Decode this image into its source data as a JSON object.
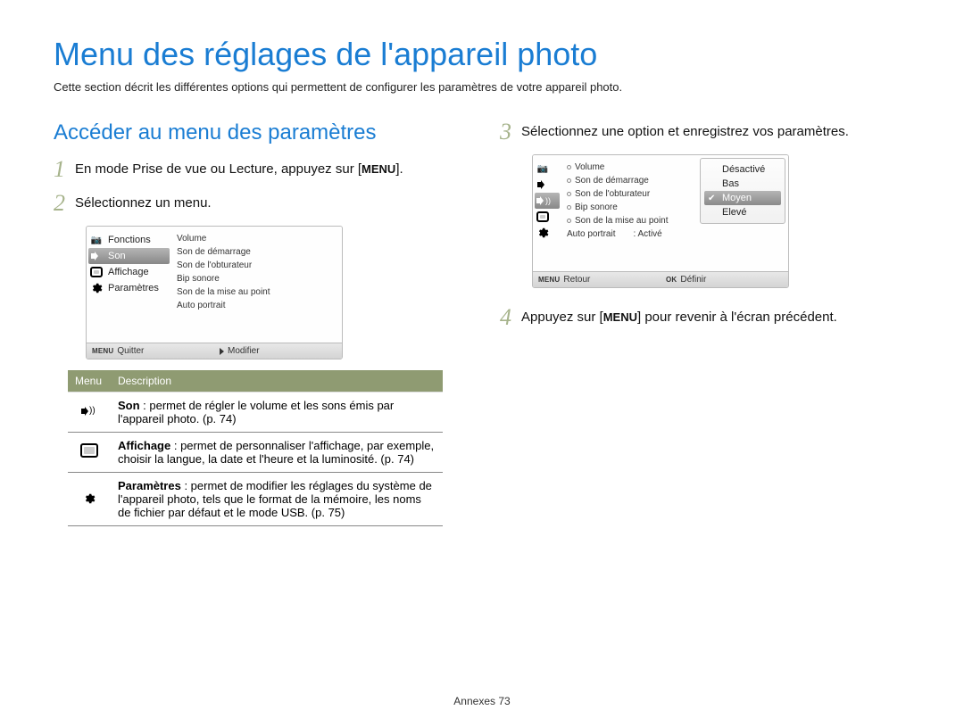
{
  "page_title": "Menu des réglages de l'appareil photo",
  "intro": "Cette section décrit les différentes options qui permettent de configurer les paramètres de votre appareil photo.",
  "subsection_title": "Accéder au menu des paramètres",
  "steps": {
    "1": {
      "n": "1",
      "pre": "En mode Prise de vue ou Lecture, appuyez sur [",
      "key": "MENU",
      "post": "]."
    },
    "2": {
      "n": "2",
      "text": "Sélectionnez un menu."
    },
    "3": {
      "n": "3",
      "text": "Sélectionnez une option et enregistrez vos paramètres."
    },
    "4": {
      "n": "4",
      "pre": "Appuyez sur [",
      "key": "MENU",
      "post": "] pour revenir à l'écran précédent."
    }
  },
  "screen1": {
    "left": [
      {
        "label": "Fonctions",
        "icon": "camera"
      },
      {
        "label": "Son",
        "icon": "speaker",
        "selected": true
      },
      {
        "label": "Affichage",
        "icon": "display"
      },
      {
        "label": "Paramètres",
        "icon": "gear"
      }
    ],
    "right": [
      "Volume",
      "Son de démarrage",
      "Son de l'obturateur",
      "Bip sonore",
      "Son de la mise au point",
      "Auto portrait"
    ],
    "footer": {
      "left_key": "MENU",
      "left": "Quitter",
      "right": "Modifier"
    }
  },
  "screen2": {
    "right": [
      "Volume",
      "Son de démarrage",
      "Son de l'obturateur",
      "Bip sonore",
      "Son de la mise au point",
      "Auto portrait"
    ],
    "auto_label": "Auto portrait",
    "auto_value": ": Activé",
    "overlay": [
      {
        "label": "Désactivé"
      },
      {
        "label": "Bas"
      },
      {
        "label": "Moyen",
        "selected": true
      },
      {
        "label": "Elevé"
      }
    ],
    "footer": {
      "left_key": "MENU",
      "left": "Retour",
      "right_key": "OK",
      "right": "Définir"
    }
  },
  "table": {
    "head": {
      "menu": "Menu",
      "desc": "Description"
    },
    "rows": [
      {
        "icon": "speaker-waves",
        "term": "Son",
        "rest": " : permet de régler le volume et les sons émis par l'appareil photo. (p. 74)"
      },
      {
        "icon": "display",
        "term": "Affichage",
        "rest": " : permet de personnaliser l'affichage, par exemple, choisir la langue, la date et l'heure et la luminosité. (p. 74)"
      },
      {
        "icon": "gear",
        "term": "Paramètres",
        "rest": " : permet de modifier les réglages du système de l'appareil photo, tels que le format de la mémoire, les noms de fichier par défaut et le mode USB. (p. 75)"
      }
    ]
  },
  "footer": {
    "section": "Annexes",
    "page": "73"
  }
}
